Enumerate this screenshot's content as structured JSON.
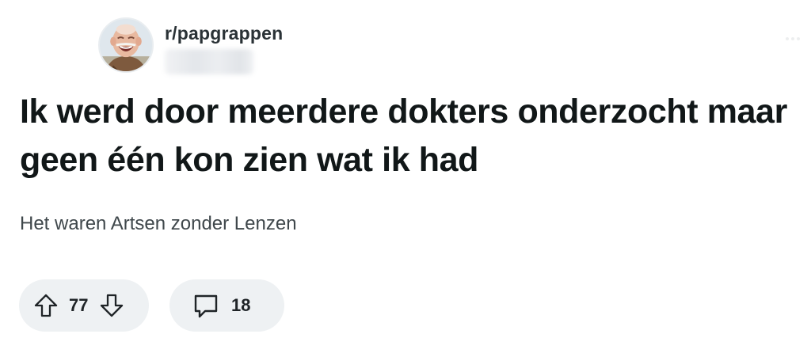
{
  "post": {
    "subreddit": "r/papgrappen",
    "username": "",
    "avatar_icon": "subreddit-avatar-laughing-man",
    "title": "Ik werd door meerdere dokters onderzocht maar geen één kon zien wat ik had",
    "body": "Het waren Artsen zonder Lenzen"
  },
  "actions": {
    "upvote_icon": "arrow-up-icon",
    "score": "77",
    "downvote_icon": "arrow-down-icon",
    "comment_icon": "speech-bubble-icon",
    "comments": "18"
  },
  "colors": {
    "background": "#ffffff",
    "text_primary": "#111718",
    "text_secondary": "#3f474b",
    "pill_background": "#eef1f3"
  }
}
